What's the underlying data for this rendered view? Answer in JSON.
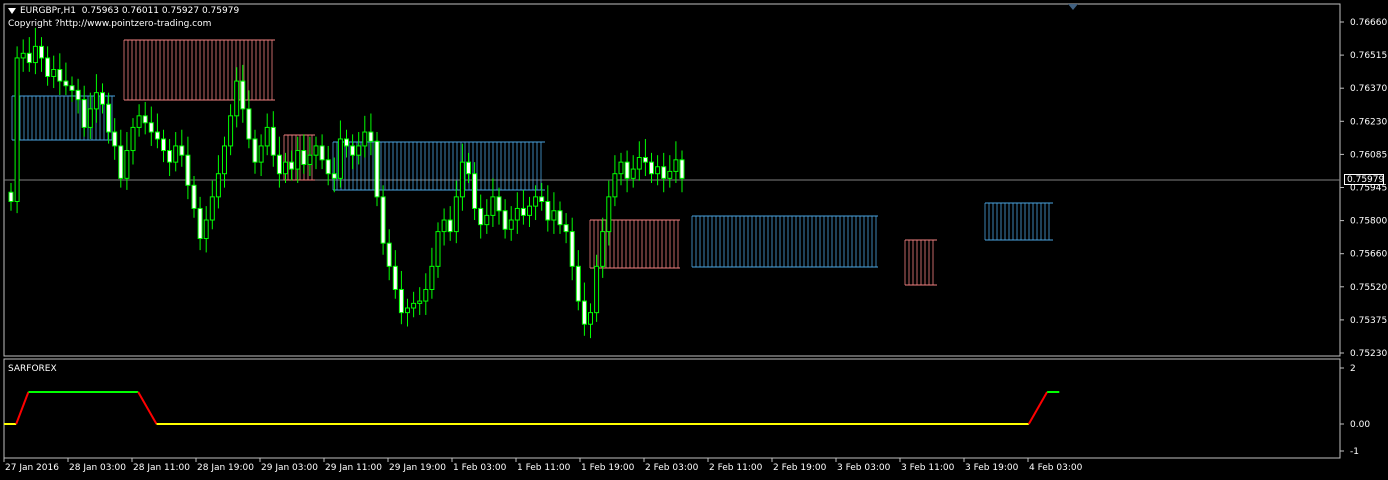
{
  "header": {
    "symbol": "EURGBPr,H1",
    "ohlc": "0.75963 0.76011 0.75927 0.75979",
    "copyright": "Copyright ?http://www.pointzero-trading.com"
  },
  "indicator": {
    "name": "SARFOREX"
  },
  "price_axis": [
    "0.76660",
    "0.76515",
    "0.76370",
    "0.76230",
    "0.76085",
    "0.75945",
    "0.75800",
    "0.75660",
    "0.75520",
    "0.75375",
    "0.75230"
  ],
  "current_price": "0.75979",
  "indicator_axis": [
    "2",
    "0.00",
    "-1"
  ],
  "time_axis": [
    "27 Jan 2016",
    "28 Jan 03:00",
    "28 Jan 11:00",
    "28 Jan 19:00",
    "29 Jan 03:00",
    "29 Jan 11:00",
    "29 Jan 19:00",
    "1 Feb 03:00",
    "1 Feb 11:00",
    "1 Feb 19:00",
    "2 Feb 03:00",
    "2 Feb 11:00",
    "2 Feb 19:00",
    "3 Feb 03:00",
    "3 Feb 11:00",
    "3 Feb 19:00",
    "4 Feb 03:00"
  ],
  "colors": {
    "bull": "#00ff00",
    "bear": "#ffffff",
    "band_up": "#4aa3df",
    "band_down": "#f08080",
    "grid": "#c0c0c0",
    "sar_green": "#00ff00",
    "sar_red": "#ff0000",
    "sar_yellow": "#ffff00"
  },
  "chart_data": {
    "type": "candlestick",
    "symbol": "EURGBPr",
    "timeframe": "H1",
    "ylim": [
      0.7523,
      0.7672
    ],
    "closes": [
      0.7588,
      0.765,
      0.7652,
      0.7648,
      0.7655,
      0.765,
      0.7642,
      0.7645,
      0.764,
      0.7638,
      0.7636,
      0.7632,
      0.762,
      0.7628,
      0.7635,
      0.763,
      0.7618,
      0.7612,
      0.7598,
      0.761,
      0.762,
      0.7625,
      0.7622,
      0.7618,
      0.7615,
      0.761,
      0.7605,
      0.7612,
      0.7608,
      0.7595,
      0.7585,
      0.7572,
      0.758,
      0.759,
      0.76,
      0.7612,
      0.7625,
      0.764,
      0.7628,
      0.7615,
      0.7605,
      0.7612,
      0.762,
      0.7608,
      0.76,
      0.7605,
      0.7602,
      0.761,
      0.7604,
      0.7608,
      0.7612,
      0.7606,
      0.76,
      0.7598,
      0.7615,
      0.7612,
      0.7608,
      0.7612,
      0.7618,
      0.7614,
      0.759,
      0.757,
      0.756,
      0.755,
      0.754,
      0.7542,
      0.7544,
      0.7545,
      0.755,
      0.756,
      0.7575,
      0.758,
      0.7575,
      0.759,
      0.7605,
      0.76,
      0.7585,
      0.7578,
      0.7582,
      0.759,
      0.7584,
      0.7576,
      0.758,
      0.7585,
      0.7582,
      0.7586,
      0.759,
      0.7588,
      0.758,
      0.7584,
      0.7578,
      0.7575,
      0.756,
      0.7545,
      0.7535,
      0.754,
      0.756,
      0.7575,
      0.759,
      0.76,
      0.7605,
      0.7598,
      0.7602,
      0.7607,
      0.7605,
      0.76,
      0.7603,
      0.7598,
      0.7601,
      0.7606,
      0.7598
    ]
  },
  "sar_data": {
    "type": "step-line",
    "ylim": [
      -1,
      2
    ],
    "segments": [
      {
        "color": "yellow",
        "from": 0,
        "to": 2,
        "value": 0
      },
      {
        "color": "red",
        "from": 2,
        "to": 4,
        "value": 1
      },
      {
        "color": "green",
        "from": 4,
        "to": 22,
        "value": 1
      },
      {
        "color": "red",
        "from": 22,
        "to": 25,
        "value": 0
      },
      {
        "color": "yellow",
        "from": 25,
        "to": 168,
        "value": 0
      },
      {
        "color": "red",
        "from": 168,
        "to": 171,
        "value": 1
      },
      {
        "color": "green",
        "from": 171,
        "to": 173,
        "value": 1
      }
    ]
  }
}
